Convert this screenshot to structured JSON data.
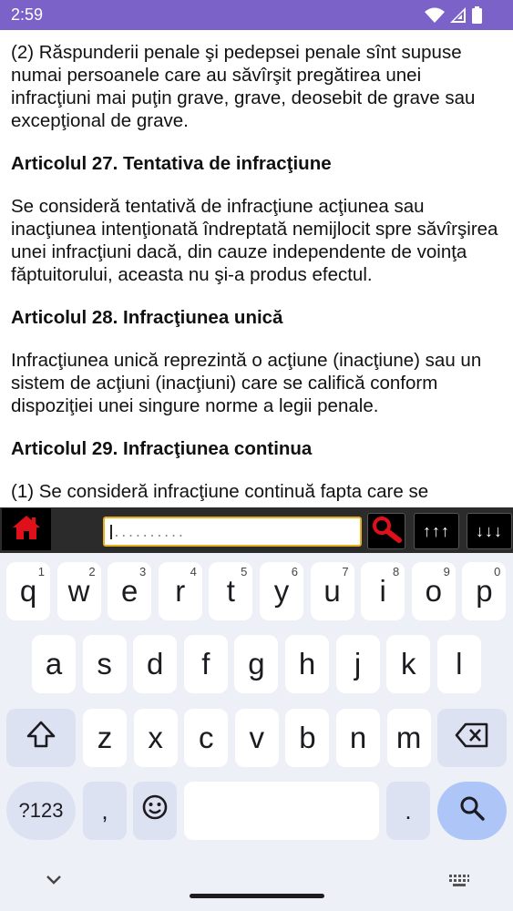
{
  "status_bar": {
    "time": "2:59",
    "icons": [
      "wifi-icon",
      "cellular-signal-icon",
      "battery-icon"
    ],
    "color": "#7b62c8"
  },
  "article": {
    "paragraphs": [
      {
        "type": "para",
        "text": "(2) Răspunderii penale şi pedepsei penale sînt supuse numai persoanele care au săvîrşit pregătirea unei infracţiuni mai puţin grave, grave, deosebit de grave sau excepţional de grave."
      },
      {
        "type": "heading",
        "text": "Articolul 27. Tentativa de infracţiune"
      },
      {
        "type": "para",
        "text": "Se consideră tentativă de infracţiune acţiunea sau inacţiunea intenţionată îndreptată nemijlocit spre săvîrşirea unei infracţiuni dacă, din cauze independente de voinţa făptuitorului, aceasta nu şi-a produs efectul."
      },
      {
        "type": "heading",
        "text": "Articolul 28. Infracţiunea unică"
      },
      {
        "type": "para",
        "text": "Infracţiunea unică reprezintă o acţiune (inacţiune) sau un sistem de acţiuni (inacţiuni) care se califică conform dispoziţiei unei singure norme a legii penale."
      },
      {
        "type": "heading",
        "text": "Articolul 29. Infracţiunea continua"
      },
      {
        "type": "para",
        "text": "(1) Se consideră infracţiune continuă fapta care se"
      }
    ]
  },
  "toolbar": {
    "home_icon": "home-icon",
    "search_placeholder": "..........",
    "search_value": "",
    "search_icon": "magnifier-icon",
    "prev_label": "↑↑↑",
    "next_label": "↓↓↓",
    "accent": "#e6b021",
    "icon_color": "#e0101a"
  },
  "keyboard": {
    "row1": [
      {
        "label": "q",
        "hint": "1"
      },
      {
        "label": "w",
        "hint": "2"
      },
      {
        "label": "e",
        "hint": "3"
      },
      {
        "label": "r",
        "hint": "4"
      },
      {
        "label": "t",
        "hint": "5"
      },
      {
        "label": "y",
        "hint": "6"
      },
      {
        "label": "u",
        "hint": "7"
      },
      {
        "label": "i",
        "hint": "8"
      },
      {
        "label": "o",
        "hint": "9"
      },
      {
        "label": "p",
        "hint": "0"
      }
    ],
    "row2": [
      "a",
      "s",
      "d",
      "f",
      "g",
      "h",
      "j",
      "k",
      "l"
    ],
    "row3": [
      "z",
      "x",
      "c",
      "v",
      "b",
      "n",
      "m"
    ],
    "shift_icon": "shift-icon",
    "backspace_icon": "backspace-icon",
    "symbols_label": "?123",
    "comma_label": ",",
    "emoji_icon": "emoji-icon",
    "period_label": ".",
    "search_key_icon": "search-icon",
    "hide_keyboard_icon": "chevron-down-icon",
    "switch_keyboard_icon": "keyboard-icon"
  }
}
